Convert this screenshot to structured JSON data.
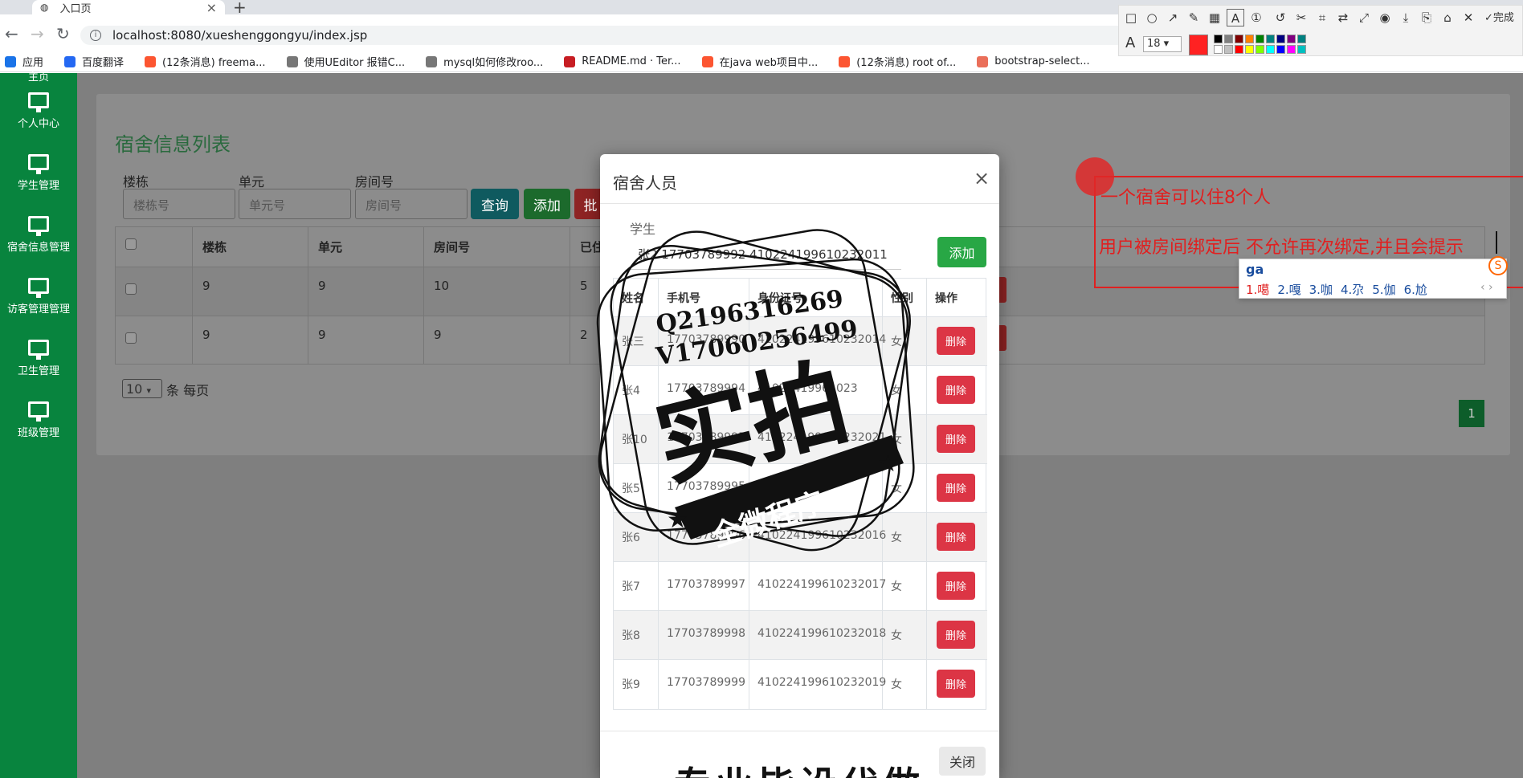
{
  "browser": {
    "tab_title": "入口页",
    "url": "localhost:8080/xueshenggongyu/index.jsp",
    "bookmarks": [
      {
        "label": "应用",
        "icon": "apps-grid-icon",
        "color": "#1a73e8"
      },
      {
        "label": "百度翻译",
        "icon": "baidu-translate-icon",
        "color": "#2468f2"
      },
      {
        "label": "(12条消息) freema...",
        "icon": "csdn-icon",
        "color": "#fc5531"
      },
      {
        "label": "使用UEditor 报错C...",
        "icon": "flame-icon",
        "color": "#777777"
      },
      {
        "label": "mysql如何修改roo...",
        "icon": "flame-icon",
        "color": "#777777"
      },
      {
        "label": "README.md · Ter...",
        "icon": "gitee-icon",
        "color": "#c71d23"
      },
      {
        "label": "在java web项目中...",
        "icon": "csdn-icon",
        "color": "#fc5531"
      },
      {
        "label": "(12条消息) root of...",
        "icon": "csdn-icon",
        "color": "#fc5531"
      },
      {
        "label": "bootstrap-select...",
        "icon": "jianshu-icon",
        "color": "#ea6f5a"
      }
    ]
  },
  "sidebar": {
    "partial_label": "主页",
    "items": [
      {
        "label": "个人中心"
      },
      {
        "label": "学生管理"
      },
      {
        "label": "宿舍信息管理"
      },
      {
        "label": "访客管理管理"
      },
      {
        "label": "卫生管理"
      },
      {
        "label": "班级管理"
      }
    ]
  },
  "list_page": {
    "title": "宿舍信息列表",
    "filters": [
      {
        "label": "楼栋",
        "placeholder": "楼栋号"
      },
      {
        "label": "单元",
        "placeholder": "单元号"
      },
      {
        "label": "房间号",
        "placeholder": "房间号"
      }
    ],
    "buttons": {
      "query": "查询",
      "add": "添加",
      "batch": "批"
    },
    "columns": [
      "楼栋",
      "单元",
      "房间号",
      "已住"
    ],
    "rows": [
      {
        "building": "9",
        "unit": "9",
        "room": "10",
        "occupied": "5"
      },
      {
        "building": "9",
        "unit": "9",
        "room": "9",
        "occupied": "2"
      }
    ],
    "page_size": "10",
    "page_size_suffix": "条 每页",
    "current_page": "1"
  },
  "modal": {
    "title": "宿舍人员",
    "close_glyph": "×",
    "student_label": "学生",
    "student_selected": "张2 17703789992 410224199610232011",
    "add_label": "添加",
    "columns": [
      "姓名",
      "手机号",
      "身份证号",
      "性别",
      "操作"
    ],
    "delete_label": "删除",
    "rows": [
      {
        "name": "张三",
        "phone": "17703789990",
        "id": "410224199610232014",
        "gender": "女"
      },
      {
        "name": "张4",
        "phone": "17703789994",
        "id": "41022419961023",
        "gender": "女"
      },
      {
        "name": "张10",
        "phone": "17703789995",
        "id": "410224199610232021",
        "gender": "女"
      },
      {
        "name": "张5",
        "phone": "17703789995",
        "id": "",
        "gender": "女"
      },
      {
        "name": "张6",
        "phone": "17703789996",
        "id": "410224199610232016",
        "gender": "女"
      },
      {
        "name": "张7",
        "phone": "17703789997",
        "id": "410224199610232017",
        "gender": "女"
      },
      {
        "name": "张8",
        "phone": "17703789998",
        "id": "410224199610232018",
        "gender": "女"
      },
      {
        "name": "张9",
        "phone": "17703789999",
        "id": "410224199610232019",
        "gender": "女"
      }
    ],
    "footer_close": "关闭"
  },
  "watermark": {
    "qq": "Q2196316269",
    "wx": "V17060256499",
    "big": "实拍",
    "ribbon": "全微程序"
  },
  "bottom_overlay_text": "专业毕设代做",
  "annotation": {
    "line1": "一个宿舍可以住8个人",
    "line2": "用户被房间绑定后 不允许再次绑定,并且会提示"
  },
  "ime": {
    "input": "ga",
    "candidates": [
      "1.噶",
      "2.嘎",
      "3.咖",
      "4.尕",
      "5.伽",
      "6.尬"
    ]
  },
  "toolbar": {
    "font_size": "18",
    "done_label": "完成",
    "current_color": "#ff2222",
    "palette": [
      "#000000",
      "#808080",
      "#800000",
      "#ff8000",
      "#008000",
      "#008080",
      "#000080",
      "#800080",
      "#008080",
      "#ffffff",
      "#c0c0c0",
      "#ff0000",
      "#ffff00",
      "#80ff00",
      "#00ffff",
      "#0000ff",
      "#ff00ff",
      "#00c0c0"
    ]
  }
}
